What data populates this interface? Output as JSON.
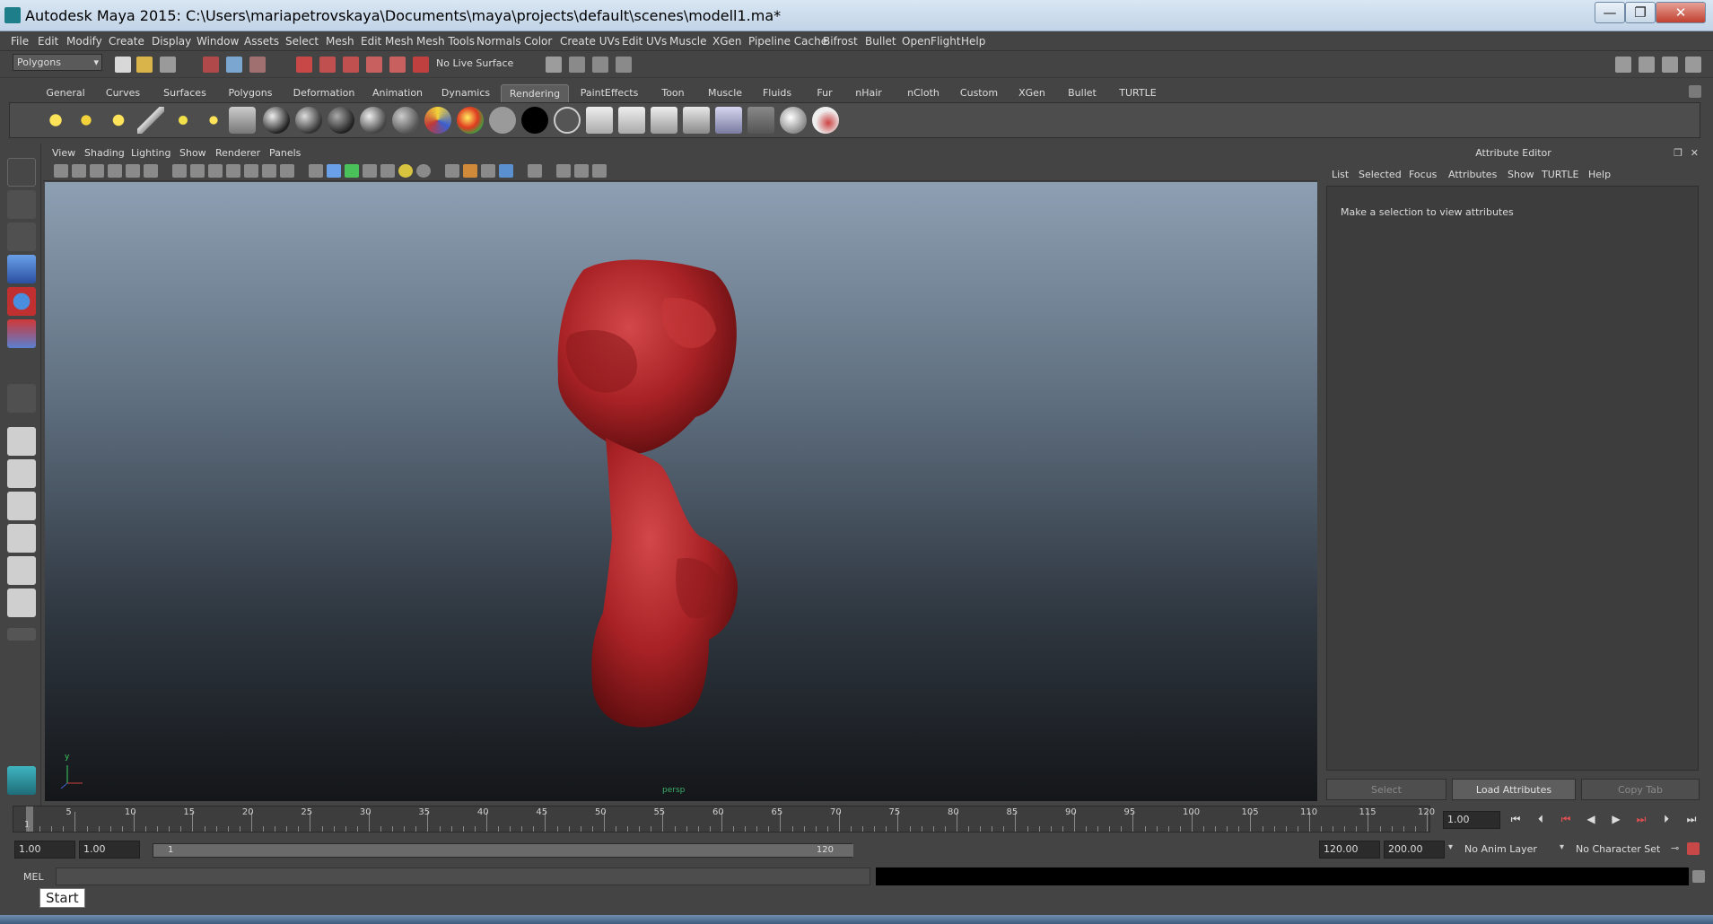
{
  "window": {
    "title": "Autodesk Maya 2015: C:\\Users\\mariapetrovskaya\\Documents\\maya\\projects\\default\\scenes\\modell1.ma*",
    "min_glyph": "—",
    "max_glyph": "❐",
    "close_glyph": "✕"
  },
  "menubar": [
    "File",
    "Edit",
    "Modify",
    "Create",
    "Display",
    "Window",
    "Assets",
    "Select",
    "Mesh",
    "Edit Mesh",
    "Mesh Tools",
    "Normals",
    "Color",
    "Create UVs",
    "Edit UVs",
    "Muscle",
    "XGen",
    "Pipeline Cache",
    "Bifrost",
    "Bullet",
    "OpenFlight",
    "Help"
  ],
  "statusline": {
    "menuset": "Polygons",
    "live_surface": "No Live Surface"
  },
  "shelf_tabs": [
    "General",
    "Curves",
    "Surfaces",
    "Polygons",
    "Deformation",
    "Animation",
    "Dynamics",
    "Rendering",
    "PaintEffects",
    "Toon",
    "Muscle",
    "Fluids",
    "Fur",
    "nHair",
    "nCloth",
    "Custom",
    "XGen",
    "Bullet",
    "TURTLE"
  ],
  "active_shelf_tab": "Rendering",
  "panel_menu": [
    "View",
    "Shading",
    "Lighting",
    "Show",
    "Renderer",
    "Panels"
  ],
  "viewport": {
    "camera_label": "persp",
    "axis_y": "y",
    "model_color": "#b3282a"
  },
  "attribute_editor": {
    "title": "Attribute Editor",
    "menu": [
      "List",
      "Selected",
      "Focus",
      "Attributes",
      "Show",
      "TURTLE",
      "Help"
    ],
    "hint": "Make a selection to view attributes",
    "buttons": {
      "select": "Select",
      "load": "Load Attributes",
      "copy": "Copy Tab"
    }
  },
  "timeline": {
    "start_label": "1",
    "ticks": [
      5,
      10,
      15,
      20,
      25,
      30,
      35,
      40,
      45,
      50,
      55,
      60,
      65,
      70,
      75,
      80,
      85,
      90,
      95,
      100,
      105,
      110,
      115,
      120
    ],
    "current_time": "1.00"
  },
  "range": {
    "start_time": "1.00",
    "playback_start": "1.00",
    "slider_start": "1",
    "slider_end": "120",
    "playback_end": "120.00",
    "end_time": "200.00",
    "anim_layer": "No Anim Layer",
    "character_set": "No Character Set"
  },
  "command": {
    "lang": "MEL"
  },
  "tooltip": "Start"
}
